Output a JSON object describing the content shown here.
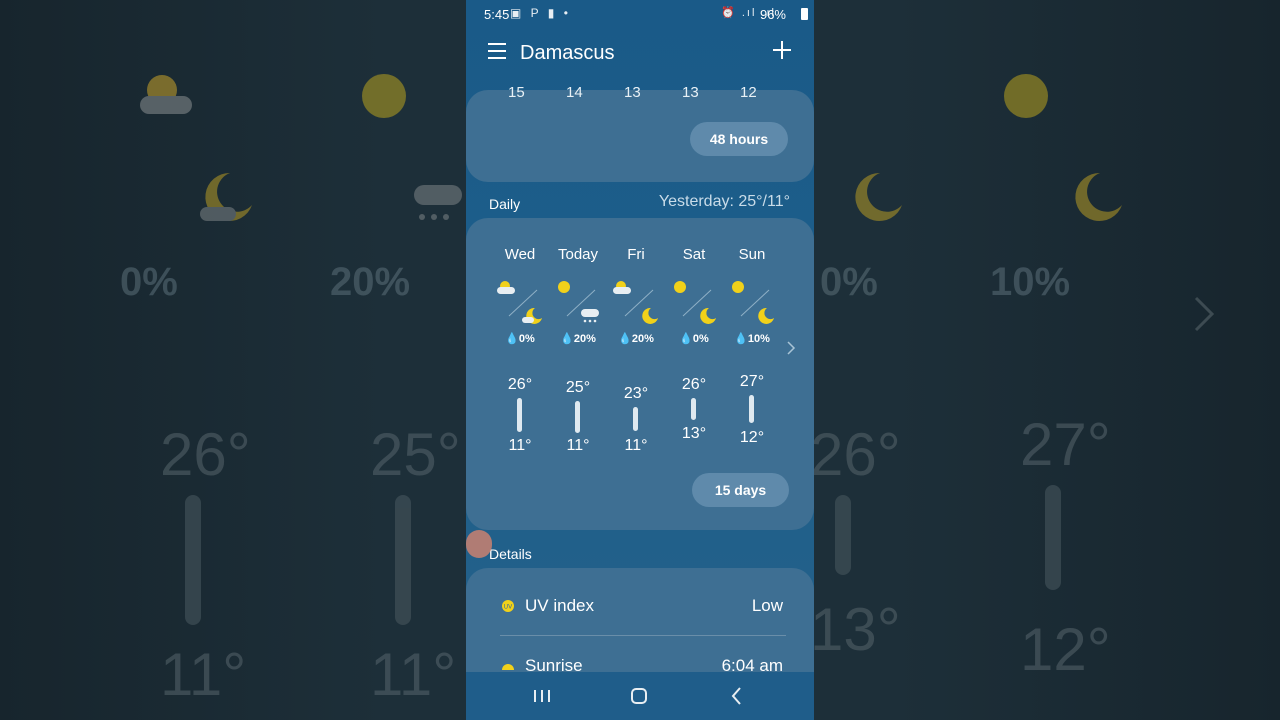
{
  "status_bar": {
    "time": "5:45",
    "left_icons": "▣ P ▮ •",
    "right_icons": "⏰ .ıl .ıl",
    "battery": "96%"
  },
  "app_bar": {
    "city": "Damascus",
    "menu_icon": "menu-icon",
    "add_icon": "plus-icon"
  },
  "hourly": {
    "temps": [
      "15",
      "14",
      "13",
      "13",
      "12"
    ],
    "button_label": "48 hours"
  },
  "daily": {
    "section_label": "Daily",
    "yesterday": "Yesterday: 25°/11°",
    "days": [
      {
        "name": "Wed",
        "day_icon": "partly-cloudy-icon",
        "night_icon": "partly-cloudy-night-icon",
        "precip": "0%",
        "high": "26°",
        "low": "11°"
      },
      {
        "name": "Today",
        "day_icon": "sun-icon",
        "night_icon": "rain-cloud-icon",
        "precip": "20%",
        "high": "25°",
        "low": "11°"
      },
      {
        "name": "Fri",
        "day_icon": "partly-cloudy-icon",
        "night_icon": "moon-icon",
        "precip": "20%",
        "high": "23°",
        "low": "11°"
      },
      {
        "name": "Sat",
        "day_icon": "sun-icon",
        "night_icon": "moon-icon",
        "precip": "0%",
        "high": "26°",
        "low": "13°"
      },
      {
        "name": "Sun",
        "day_icon": "sun-icon",
        "night_icon": "moon-icon",
        "precip": "10%",
        "high": "27°",
        "low": "12°"
      }
    ],
    "button_label": "15 days"
  },
  "details": {
    "section_label": "Details",
    "rows": [
      {
        "label": "UV index",
        "value": "Low",
        "icon": "uv-icon"
      },
      {
        "label": "Sunrise",
        "value": "6:04 am",
        "icon": "sunrise-icon"
      }
    ]
  },
  "background": {
    "columns": [
      {
        "precip": "0%",
        "high": "26°",
        "low": "11°"
      },
      {
        "precip": "20%",
        "high": "25°",
        "low": "11°"
      },
      {
        "precip": "0%",
        "high": "26°",
        "low": "13°"
      },
      {
        "precip": "10%",
        "high": "27°",
        "low": "12°"
      }
    ]
  },
  "nav_bar": {
    "recents_icon": "recents-icon",
    "home_icon": "home-icon",
    "back_icon": "back-icon"
  },
  "colors": {
    "sun": "#f1d11a",
    "accent_card": "#3e6f93",
    "pill": "#5f8aab"
  }
}
